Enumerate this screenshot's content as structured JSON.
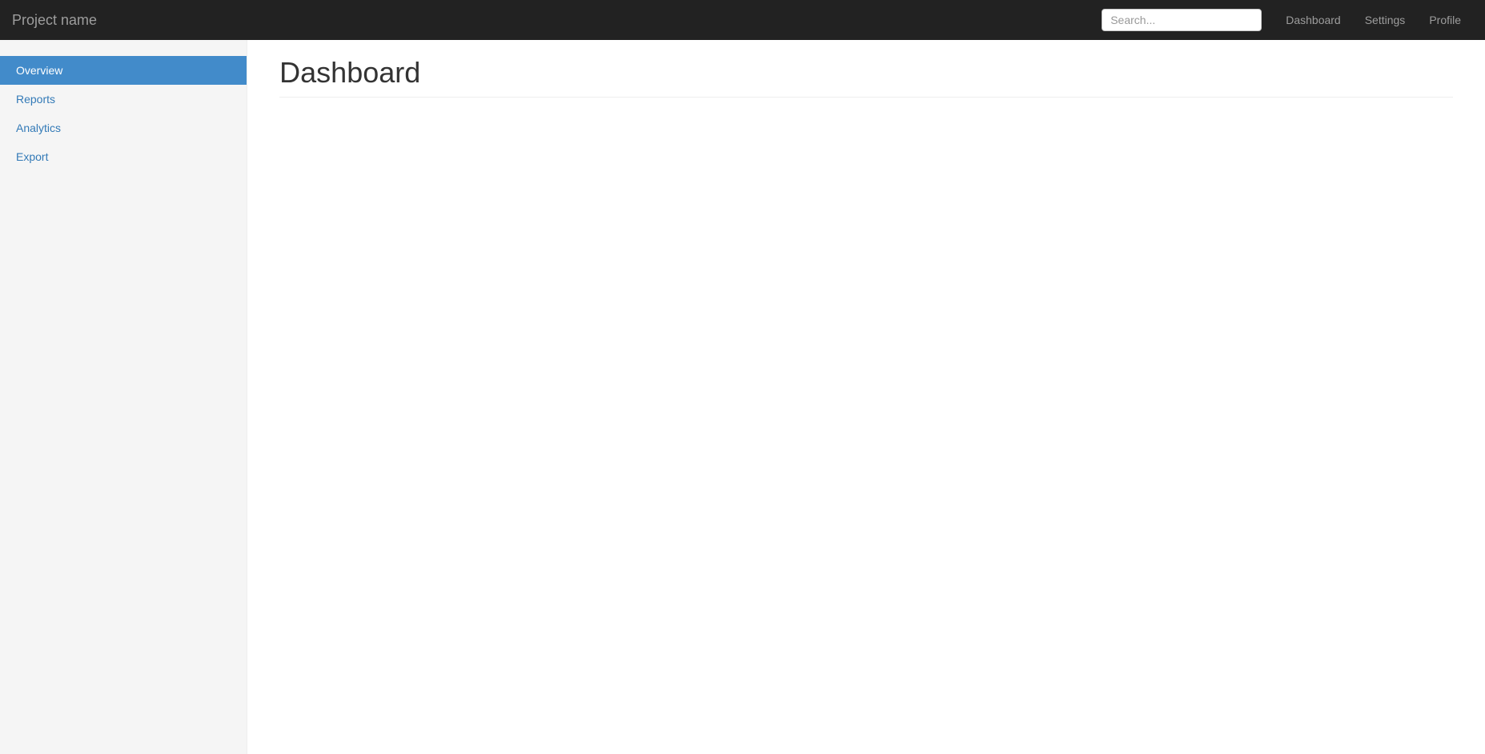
{
  "navbar": {
    "brand": "Project name",
    "search_placeholder": "Search...",
    "links": [
      {
        "label": "Dashboard"
      },
      {
        "label": "Settings"
      },
      {
        "label": "Profile"
      }
    ]
  },
  "sidebar": {
    "items": [
      {
        "label": "Overview",
        "active": true
      },
      {
        "label": "Reports",
        "active": false
      },
      {
        "label": "Analytics",
        "active": false
      },
      {
        "label": "Export",
        "active": false
      }
    ]
  },
  "main": {
    "title": "Dashboard"
  }
}
